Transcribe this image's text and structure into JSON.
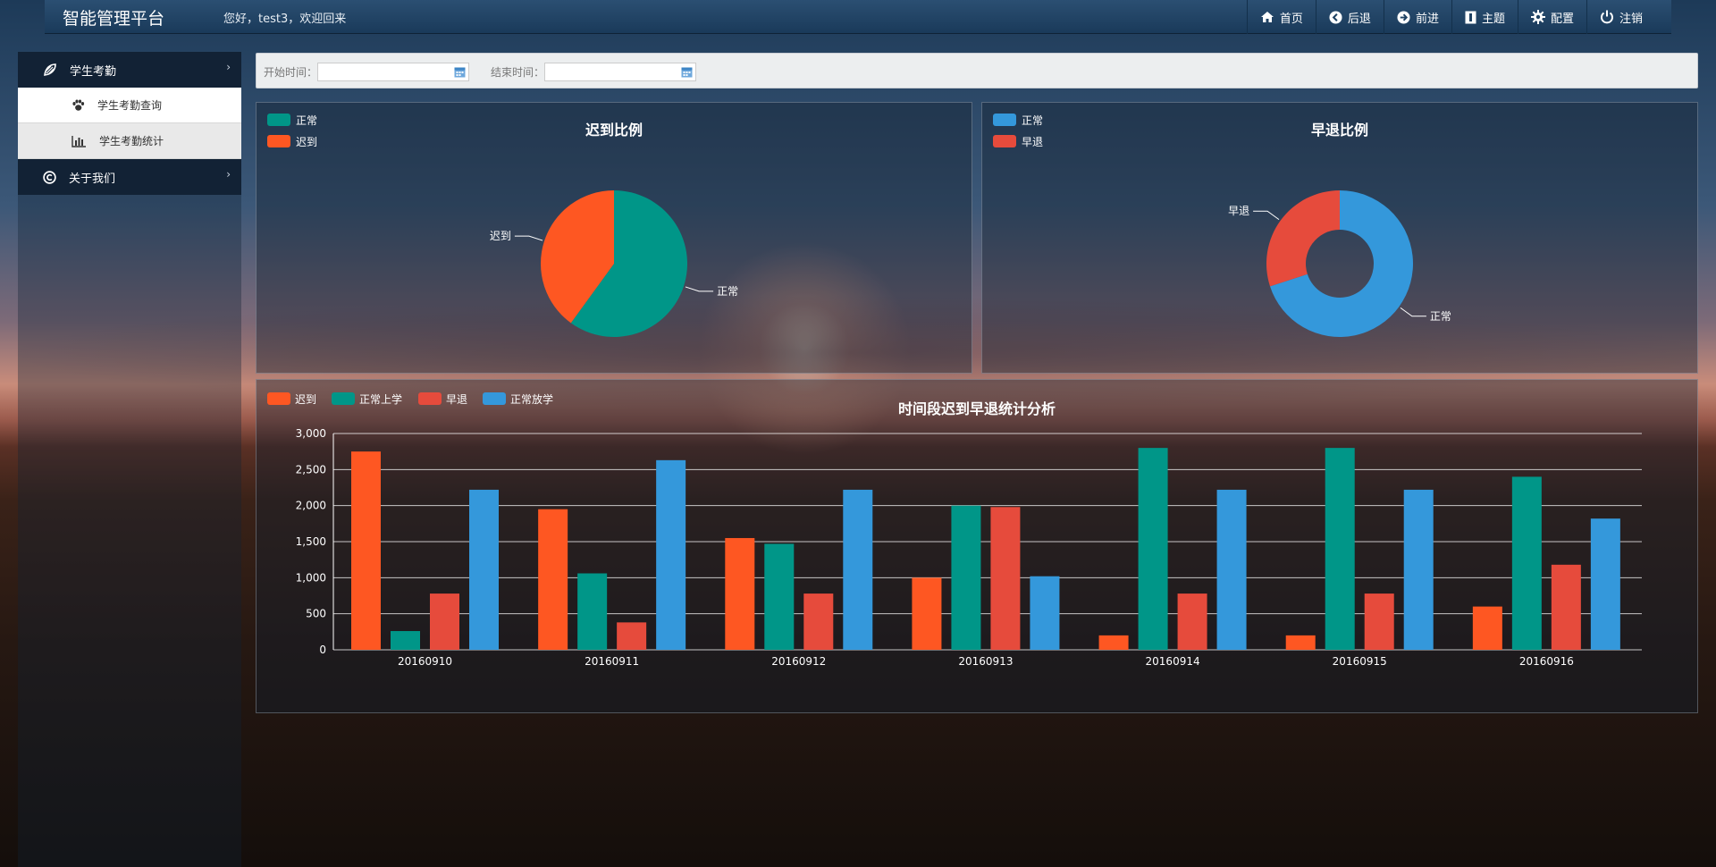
{
  "header": {
    "brand": "智能管理平台",
    "welcome": "您好，test3，欢迎回来",
    "nav": [
      {
        "label": "首页",
        "icon": "home-icon"
      },
      {
        "label": "后退",
        "icon": "arrow-left-icon"
      },
      {
        "label": "前进",
        "icon": "arrow-right-icon"
      },
      {
        "label": "主题",
        "icon": "theme-icon"
      },
      {
        "label": "配置",
        "icon": "gear-icon"
      },
      {
        "label": "注销",
        "icon": "power-icon"
      }
    ]
  },
  "sidebar": {
    "groups": [
      {
        "label": "学生考勤",
        "icon": "leaf-icon",
        "expanded": true,
        "items": [
          {
            "label": "学生考勤查询",
            "icon": "paw-icon"
          },
          {
            "label": "学生考勤统计",
            "icon": "bar-chart-icon"
          }
        ]
      },
      {
        "label": "关于我们",
        "icon": "copyright-icon",
        "expanded": false
      }
    ]
  },
  "filters": {
    "start_label": "开始时间：",
    "start_value": "",
    "end_label": "结束时间：",
    "end_value": ""
  },
  "colors": {
    "late": "#fe5722",
    "normal_in": "#009688",
    "early": "#e64b3c",
    "normal_out": "#3498db"
  },
  "chart_data": [
    {
      "type": "pie",
      "title": "迟到比例",
      "legend": [
        "正常",
        "迟到"
      ],
      "legend_position": "top-left",
      "slices": [
        {
          "name": "正常",
          "value": 60,
          "color": "#009688"
        },
        {
          "name": "迟到",
          "value": 40,
          "color": "#fe5722"
        }
      ]
    },
    {
      "type": "pie",
      "title": "早退比例",
      "legend": [
        "正常",
        "早退"
      ],
      "legend_position": "top-left",
      "donut": true,
      "slices": [
        {
          "name": "正常",
          "value": 70,
          "color": "#3498db"
        },
        {
          "name": "早退",
          "value": 30,
          "color": "#e64b3c"
        }
      ]
    },
    {
      "type": "bar",
      "title": "时间段迟到早退统计分析",
      "legend_position": "top-left",
      "grid": true,
      "categories": [
        "20160910",
        "20160911",
        "20160912",
        "20160913",
        "20160914",
        "20160915",
        "20160916"
      ],
      "ylim": [
        0,
        3000
      ],
      "yticks": [
        "0",
        "500",
        "1,000",
        "1,500",
        "2,000",
        "2,500",
        "3,000"
      ],
      "series": [
        {
          "name": "迟到",
          "color": "#fe5722",
          "values": [
            2750,
            1950,
            1550,
            1000,
            200,
            200,
            600
          ]
        },
        {
          "name": "正常上学",
          "color": "#009688",
          "values": [
            260,
            1060,
            1470,
            2000,
            2800,
            2800,
            2400
          ]
        },
        {
          "name": "早退",
          "color": "#e64b3c",
          "values": [
            780,
            380,
            780,
            1980,
            780,
            780,
            1180
          ]
        },
        {
          "name": "正常放学",
          "color": "#3498db",
          "values": [
            2220,
            2630,
            2220,
            1020,
            2220,
            2220,
            1820
          ]
        }
      ]
    }
  ]
}
